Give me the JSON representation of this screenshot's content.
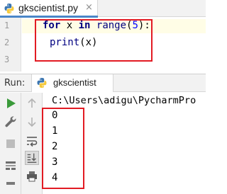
{
  "editor_tab": {
    "filename": "gkscientist.py",
    "close_glyph": "×",
    "icon": "python-file-icon"
  },
  "editor": {
    "line_numbers": [
      "1",
      "2",
      "3"
    ],
    "code": {
      "line1": {
        "kw_for": "for",
        "var": " x ",
        "kw_in": "in",
        "space": " ",
        "func": "range",
        "open": "(",
        "num": "5",
        "close": "):"
      },
      "line2": {
        "func": "print",
        "args": "(x)"
      },
      "line3": ""
    }
  },
  "run_panel": {
    "label": "Run:",
    "tab_title": "gkscientist",
    "tab_icon": "python-file-icon",
    "tools_left": [
      "run-icon",
      "wrench-icon",
      "stop-icon",
      "layout-icon",
      "pin-icon"
    ],
    "tools_right": [
      "up-arrow-icon",
      "down-arrow-icon",
      "soft-wrap-icon",
      "scroll-to-end-icon",
      "print-icon"
    ],
    "console": {
      "command": "C:\\Users\\adigu\\PycharmPro",
      "output": [
        "0",
        "1",
        "2",
        "3",
        "4"
      ]
    }
  },
  "colors": {
    "highlight_box": "#e21b23",
    "keyword": "#000080",
    "number": "#0000ff",
    "run_green": "#3a9a3a"
  }
}
